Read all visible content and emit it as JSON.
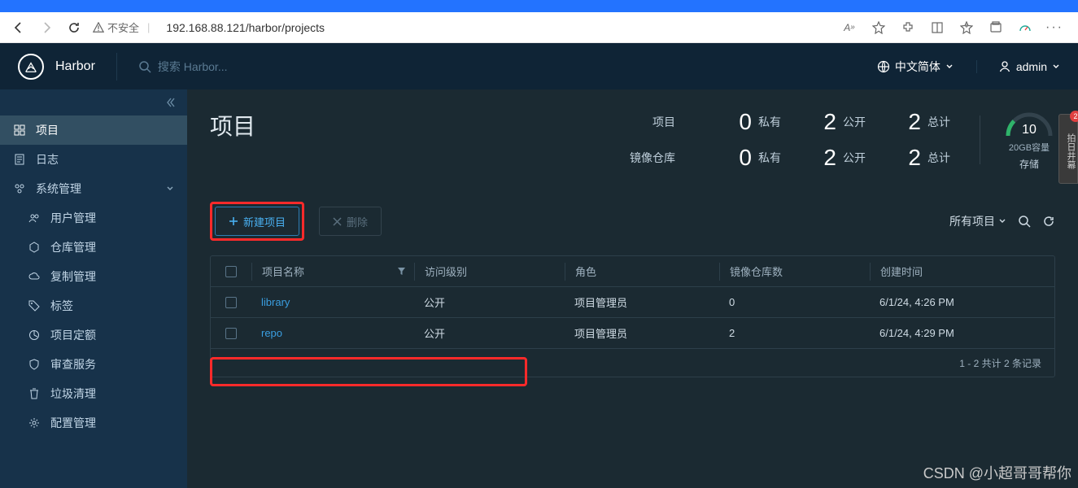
{
  "browser": {
    "url": "192.168.88.121/harbor/projects",
    "insecure_label": "不安全"
  },
  "header": {
    "brand": "Harbor",
    "search_placeholder": "搜索 Harbor...",
    "language": "中文简体",
    "user": "admin"
  },
  "sidebar": {
    "items": [
      {
        "label": "项目"
      },
      {
        "label": "日志"
      },
      {
        "label": "系统管理"
      }
    ],
    "system_sub": [
      {
        "label": "用户管理"
      },
      {
        "label": "仓库管理"
      },
      {
        "label": "复制管理"
      },
      {
        "label": "标签"
      },
      {
        "label": "项目定额"
      },
      {
        "label": "审查服务"
      },
      {
        "label": "垃圾清理"
      },
      {
        "label": "配置管理"
      }
    ]
  },
  "page": {
    "title": "项目",
    "stat_labels": {
      "projects": "项目",
      "repos": "镜像仓库",
      "private": "私有",
      "public": "公开",
      "total": "总计"
    },
    "stats": {
      "projects": {
        "private": "0",
        "public": "2",
        "total": "2"
      },
      "repos": {
        "private": "0",
        "public": "2",
        "total": "2"
      }
    },
    "gauge": {
      "value": "10",
      "capacity": "20GB容量",
      "label": "存储"
    }
  },
  "actions": {
    "new_project": "新建项目",
    "delete": "删除",
    "filter_label": "所有项目"
  },
  "table": {
    "headers": {
      "name": "项目名称",
      "access": "访问级别",
      "role": "角色",
      "repo_count": "镜像仓库数",
      "created": "创建时间"
    },
    "rows": [
      {
        "name": "library",
        "access": "公开",
        "role": "项目管理员",
        "repo_count": "0",
        "created": "6/1/24, 4:26 PM"
      },
      {
        "name": "repo",
        "access": "公开",
        "role": "项目管理员",
        "repo_count": "2",
        "created": "6/1/24, 4:29 PM"
      }
    ],
    "footer": "1 - 2 共计 2 条记录"
  },
  "side_tab": {
    "label": "拍日井幕",
    "badge": "2"
  },
  "watermark": "CSDN @小超哥哥帮你"
}
